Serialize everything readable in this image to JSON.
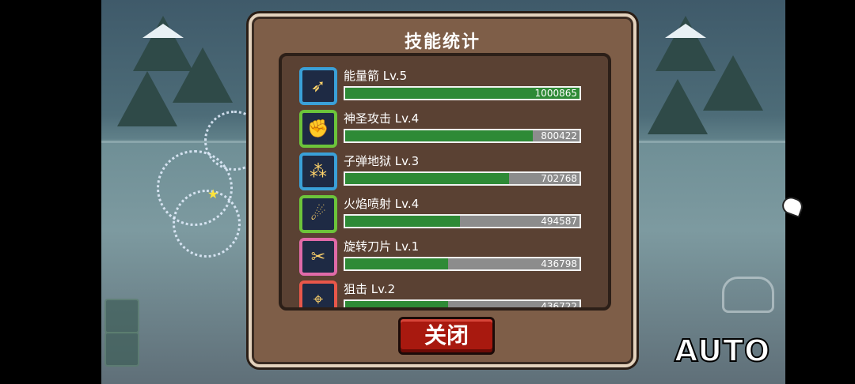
{
  "panel": {
    "title": "技能统计",
    "close_label": "关闭"
  },
  "hud": {
    "auto_label": "AUTO"
  },
  "skills": [
    {
      "name": "能量箭 Lv.5",
      "value": "1000865",
      "fill": 1.0,
      "icon": "energy-arrow-icon",
      "frame": "blue"
    },
    {
      "name": "神圣攻击 Lv.4",
      "value": "800422",
      "fill": 0.8,
      "icon": "holy-attack-icon",
      "frame": "green"
    },
    {
      "name": "子弹地狱 Lv.3",
      "value": "702768",
      "fill": 0.7,
      "icon": "bullet-hell-icon",
      "frame": "blue"
    },
    {
      "name": "火焰喷射 Lv.4",
      "value": "494587",
      "fill": 0.49,
      "icon": "fire-spray-icon",
      "frame": "green"
    },
    {
      "name": "旋转刀片 Lv.1",
      "value": "436798",
      "fill": 0.44,
      "icon": "spin-blade-icon",
      "frame": "pink"
    },
    {
      "name": "狙击 Lv.2",
      "value": "436722",
      "fill": 0.44,
      "icon": "snipe-icon",
      "frame": "red"
    }
  ],
  "colors": {
    "bar_fill": "#2e8a36",
    "bar_empty": "#8c8c8c",
    "panel_bg": "#7e5e48",
    "close_button": "#a8190f"
  }
}
